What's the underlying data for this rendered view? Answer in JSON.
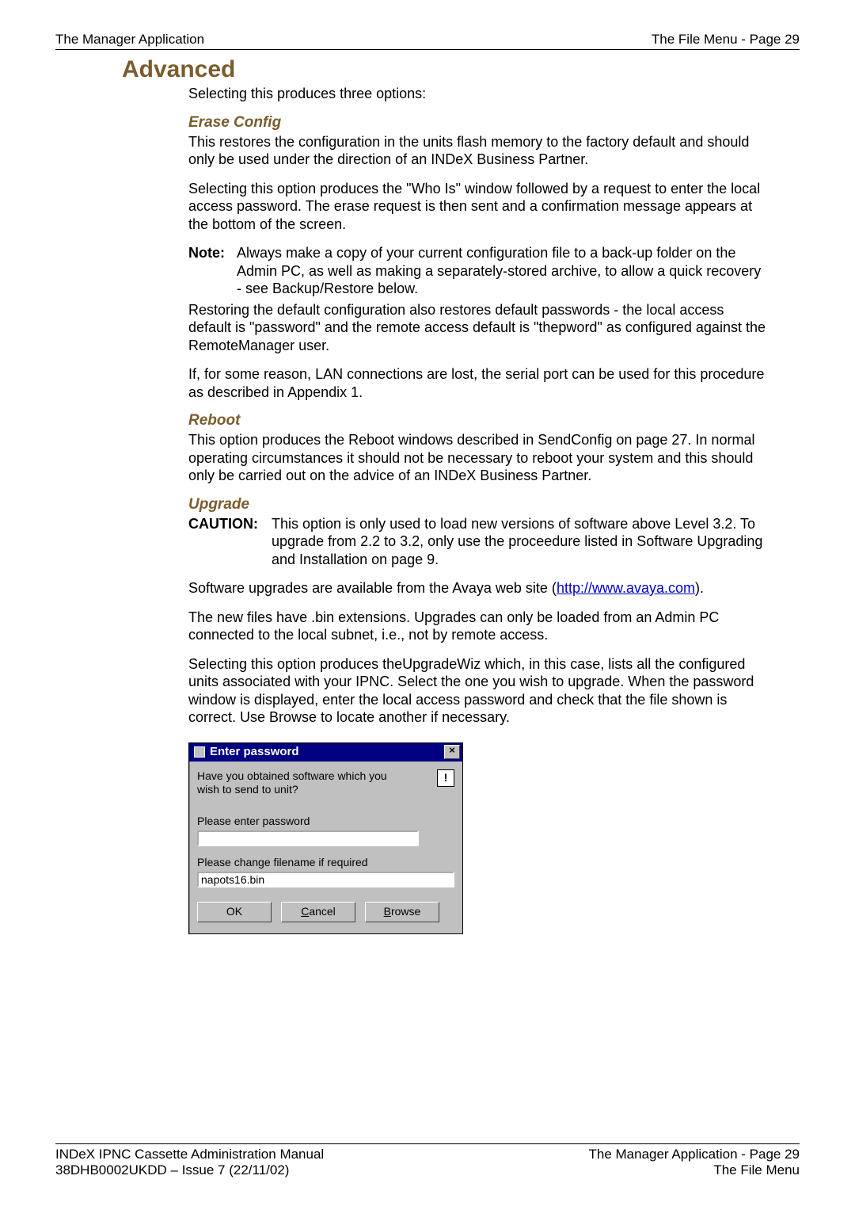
{
  "header": {
    "left": "The Manager Application",
    "right": "The File Menu - Page 29"
  },
  "section_title": "Advanced",
  "intro": "Selecting this produces three options:",
  "erase": {
    "heading": "Erase Config",
    "p1": "This restores the configuration in the units flash memory to the factory default and should only be used under the direction of an INDeX Business Partner.",
    "p2": "Selecting this option produces the \"Who Is\" window followed by a request to enter the local access password. The erase request is then sent and a confirmation message appears at the bottom of the screen.",
    "note_label": "Note:",
    "note_body": "Always make a copy of your current configuration file to a back-up folder on the Admin PC, as well as making a separately-stored archive, to allow a quick recovery - see Backup/Restore below.",
    "p3": "Restoring the default configuration also restores default passwords - the local access default is \"password\" and the remote access default is \"thepword\" as configured against the RemoteManager user.",
    "p4": "If, for some reason, LAN connections are lost, the serial port can be used for this procedure as described in Appendix 1."
  },
  "reboot": {
    "heading": "Reboot",
    "p1": "This option produces the Reboot windows described in SendConfig on page 27. In normal operating circumstances it should not be necessary to reboot your system and this should only be carried out on the advice of an INDeX Business Partner."
  },
  "upgrade": {
    "heading": "Upgrade",
    "caution_label": "CAUTION:",
    "caution_body": "This option is only used to load new versions of software above Level 3.2. To upgrade from 2.2 to 3.2, only use the proceedure listed in Software Upgrading and Installation on page 9.",
    "p1_pre": "Software upgrades are available from the Avaya web site (",
    "link_text": "http://www.avaya.com",
    "p1_post": ").",
    "p2": "The new files have .bin extensions. Upgrades can only be loaded from an Admin PC connected to the local subnet, i.e., not by remote access.",
    "p3": "Selecting this option produces theUpgradeWiz which, in this case, lists all the configured units associated with your IPNC. Select the one you wish to upgrade. When the password window is displayed, enter the local access password and check that the file shown is correct. Use Browse to locate another if necessary."
  },
  "dialog": {
    "title": "Enter password",
    "close": "×",
    "prompt": "Have you obtained software which you wish to send to unit?",
    "warn": "!",
    "label_password": "Please enter password",
    "password_value": "",
    "label_filename": "Please change filename if required",
    "filename_value": "napots16.bin",
    "btn_ok": "OK",
    "btn_cancel_u": "C",
    "btn_cancel_rest": "ancel",
    "btn_browse_u": "B",
    "btn_browse_rest": "rowse"
  },
  "footer": {
    "l1": "INDeX IPNC Cassette Administration Manual",
    "r1": "The Manager Application - Page 29",
    "l2": "38DHB0002UKDD – Issue 7 (22/11/02)",
    "r2": "The File Menu"
  }
}
